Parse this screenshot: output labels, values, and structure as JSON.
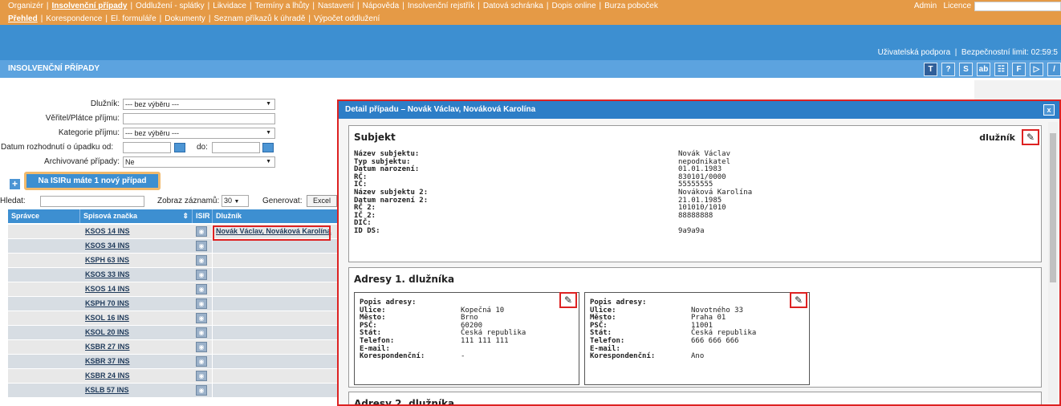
{
  "top_menu": {
    "items": [
      "Organizér",
      "Insolvenční případy",
      "Oddlužení - splátky",
      "Likvidace",
      "Termíny a lhůty",
      "Nastavení",
      "Nápověda",
      "Insolvenční rejstřík",
      "Datová schránka",
      "Dopis online",
      "Burza poboček"
    ],
    "active_index": 1,
    "admin_label": "Admin",
    "licence_label": "Licence"
  },
  "sub_menu": {
    "items": [
      "Přehled",
      "Korespondence",
      "El. formuláře",
      "Dokumenty",
      "Seznam příkazů k úhradě",
      "Výpočet oddlužení"
    ],
    "active_index": 0
  },
  "support_bar": {
    "support": "Uživatelská podpora",
    "sep": "|",
    "limit": "Bezpečnostní limit: 02:59:5"
  },
  "section_title": "INSOLVENČNÍ PŘÍPADY",
  "toolbar": {
    "icons": [
      "T",
      "?",
      "S",
      "ab",
      "☷",
      "F",
      "▷",
      "/"
    ]
  },
  "filters": {
    "dluznik_label": "Dlužník:",
    "dluznik_value": "--- bez výběru ---",
    "veritel_label": "Věřitel/Plátce příjmu:",
    "kategorie_label": "Kategorie příjmu:",
    "kategorie_value": "--- bez výběru ---",
    "datum_label": "Datum rozhodnutí o úpadku od:",
    "do_label": "do:",
    "archiv_label": "Archivované případy:",
    "archiv_value": "Ne"
  },
  "new_case_button": "Na ISIRu máte 1 nový případ",
  "search": {
    "label": "Hledat:",
    "show_label": "Zobraz záznamů:",
    "show_value": "30",
    "generate_label": "Generovat:",
    "excel_label": "Excel"
  },
  "grid": {
    "headers": [
      "Správce",
      "Spisová značka",
      "ISIR",
      "Dlužník"
    ],
    "rows": [
      {
        "spis": "KSOS 14 INS",
        "dluznik": "Novák Václav, Nováková Karolína"
      },
      {
        "spis": "KSOS 34 INS",
        "dluznik": ""
      },
      {
        "spis": "KSPH 63 INS",
        "dluznik": ""
      },
      {
        "spis": "KSOS 33 INS",
        "dluznik": ""
      },
      {
        "spis": "KSOS 14 INS",
        "dluznik": ""
      },
      {
        "spis": "KSPH 70 INS",
        "dluznik": ""
      },
      {
        "spis": "KSOL 16 INS",
        "dluznik": ""
      },
      {
        "spis": "KSOL 20 INS",
        "dluznik": ""
      },
      {
        "spis": "KSBR 27 INS",
        "dluznik": ""
      },
      {
        "spis": "KSBR 37 INS",
        "dluznik": ""
      },
      {
        "spis": "KSBR 24 INS",
        "dluznik": ""
      },
      {
        "spis": "KSLB 57 INS",
        "dluznik": ""
      }
    ]
  },
  "detail": {
    "title": "Detail případu – Novák Václav, Nováková Karolína",
    "close": "x",
    "subjekt": {
      "title": "Subjekt",
      "role": "dlužník",
      "fields": [
        {
          "k": "Název subjektu:",
          "v": "Novák Václav"
        },
        {
          "k": "Typ subjektu:",
          "v": "nepodnikatel"
        },
        {
          "k": "Datum narození:",
          "v": "01.01.1983"
        },
        {
          "k": "RČ:",
          "v": "830101/0000"
        },
        {
          "k": "IČ:",
          "v": "55555555"
        },
        {
          "k": "Název subjektu 2:",
          "v": "Nováková Karolína"
        },
        {
          "k": "Datum narození 2:",
          "v": "21.01.1985"
        },
        {
          "k": "RČ 2:",
          "v": "101010/1010"
        },
        {
          "k": "IČ 2:",
          "v": "88888888"
        },
        {
          "k": "DIČ:",
          "v": ""
        },
        {
          "k": "ID DS:",
          "v": "9a9a9a"
        }
      ]
    },
    "adresy1": {
      "title": "Adresy 1. dlužníka",
      "cards": [
        {
          "rows": [
            {
              "k": "Popis adresy:",
              "v": ""
            },
            {
              "k": "Ulice:",
              "v": "Kopečná 10"
            },
            {
              "k": "Město:",
              "v": "Brno"
            },
            {
              "k": "PSČ:",
              "v": "60200"
            },
            {
              "k": "Stát:",
              "v": "Česká republika"
            },
            {
              "k": "Telefon:",
              "v": "111 111 111"
            },
            {
              "k": "E-mail:",
              "v": ""
            },
            {
              "k": "Korespondenční:",
              "v": "-"
            }
          ]
        },
        {
          "rows": [
            {
              "k": "Popis adresy:",
              "v": ""
            },
            {
              "k": "Ulice:",
              "v": "Novotného 33"
            },
            {
              "k": "Město:",
              "v": "Praha 01"
            },
            {
              "k": "PSČ:",
              "v": "11001"
            },
            {
              "k": "Stát:",
              "v": "Česká republika"
            },
            {
              "k": "Telefon:",
              "v": "666 666 666"
            },
            {
              "k": "E-mail:",
              "v": ""
            },
            {
              "k": "Korespondenční:",
              "v": "Ano"
            }
          ]
        }
      ]
    },
    "adresy2": {
      "title": "Adresy 2. dlužníka"
    }
  }
}
